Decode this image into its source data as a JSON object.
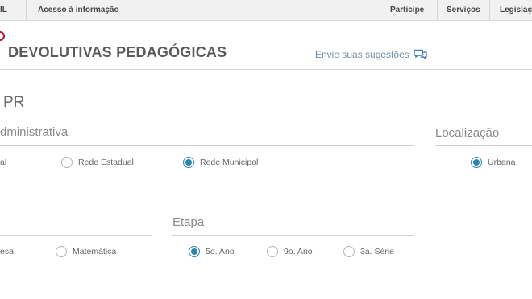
{
  "govbar": {
    "brand_fragment": "IL",
    "access_info": "Acesso à informação",
    "participe": "Participe",
    "servicos": "Serviços",
    "legislacao": "Legislaç"
  },
  "header": {
    "title": "DEVOLUTIVAS PEDAGÓGICAS",
    "suggest_link": "Envie suas sugestões",
    "suggest_icon": "chat-bubbles-icon"
  },
  "page": {
    "subtitle": "PR"
  },
  "rede": {
    "title": "dministrativa",
    "options": [
      {
        "label": "al",
        "checked": false
      },
      {
        "label": "Rede Estadual",
        "checked": false
      },
      {
        "label": "Rede Municipal",
        "checked": true
      }
    ]
  },
  "localizacao": {
    "title": "Localização",
    "options": [
      {
        "label": "Urbana",
        "checked": true
      }
    ]
  },
  "disciplina": {
    "options": [
      {
        "label": "esa",
        "checked": false
      },
      {
        "label": "Matemática",
        "checked": false
      }
    ]
  },
  "etapa": {
    "title": "Etapa",
    "options": [
      {
        "label": "5o. Ano",
        "checked": true
      },
      {
        "label": "9o. Ano",
        "checked": false
      },
      {
        "label": "3a. Série",
        "checked": false
      }
    ]
  },
  "colors": {
    "accent": "#2a86b0",
    "brand_red": "#c8102e",
    "link": "#6f8ea8"
  }
}
